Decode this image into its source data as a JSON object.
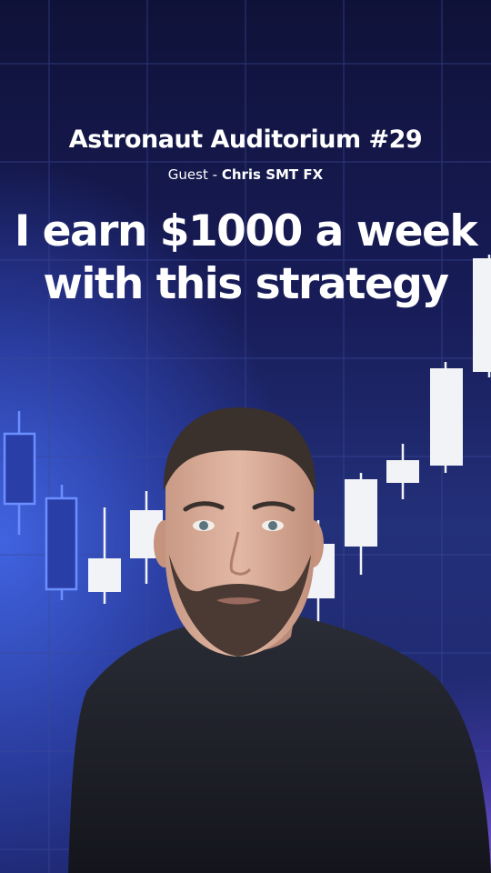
{
  "header": {
    "show_title": "Astronaut Auditorium #29",
    "guest_prefix": "Guest - ",
    "guest_name": "Chris SMT FX"
  },
  "headline": {
    "line1": "I earn $1000 a week",
    "line2": "with this strategy"
  },
  "colors": {
    "candle_fill": "#f2f3f7",
    "candle_outline": "#5f86ff",
    "grid": "#3c4a9a",
    "accent_purple": "#a070f0"
  }
}
